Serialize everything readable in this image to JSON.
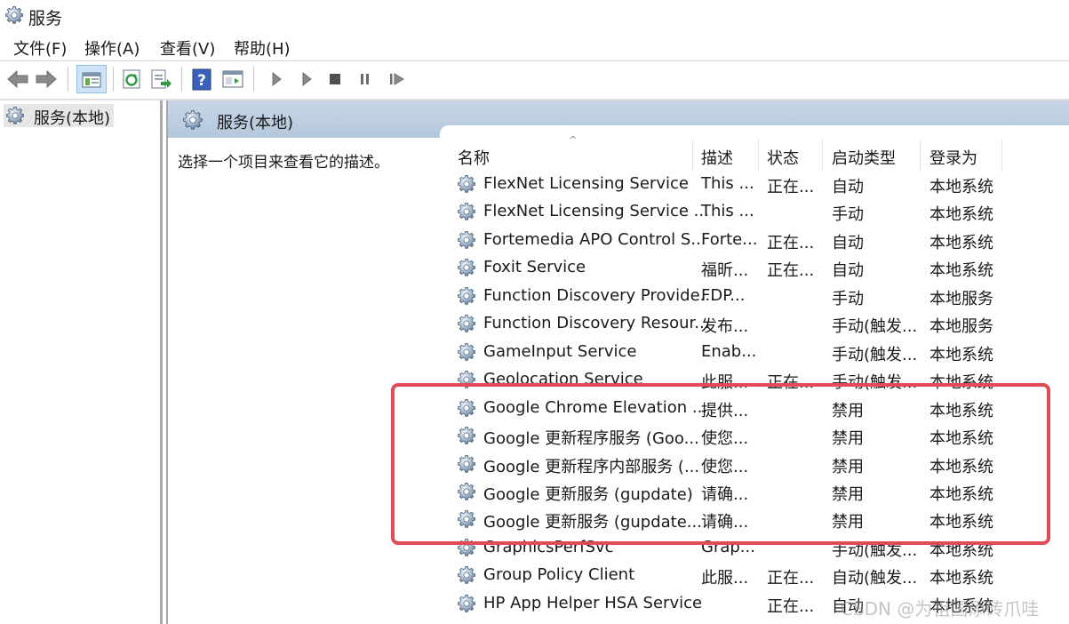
{
  "window": {
    "title": "服务",
    "icon": "services-gear-icon"
  },
  "menu": [
    "文件(F)",
    "操作(A)",
    "查看(V)",
    "帮助(H)"
  ],
  "toolbar": {
    "buttons": [
      "back-arrow-icon",
      "forward-arrow-icon",
      "show-console-tree-icon",
      "refresh-icon",
      "export-list-icon",
      "help-icon",
      "properties-icon",
      "start-service-icon",
      "start-service-alt-icon",
      "stop-service-icon",
      "pause-service-icon",
      "resume-service-icon"
    ]
  },
  "tree": {
    "selected_node": "服务(本地)"
  },
  "pane": {
    "header": "服务(本地)",
    "description_hint": "选择一个项目来查看它的描述。"
  },
  "columns": [
    "名称",
    "描述",
    "状态",
    "启动类型",
    "登录为"
  ],
  "sort_indicator": "^",
  "rows": [
    {
      "name": "FlexNet Licensing Service",
      "desc": "This ...",
      "status": "正在...",
      "startup": "自动",
      "logon": "本地系统"
    },
    {
      "name": "FlexNet Licensing Service ...",
      "desc": "This ...",
      "status": "",
      "startup": "手动",
      "logon": "本地系统"
    },
    {
      "name": "Fortemedia APO Control S...",
      "desc": "Forte...",
      "status": "正在...",
      "startup": "自动",
      "logon": "本地系统"
    },
    {
      "name": "Foxit Service",
      "desc": "福昕...",
      "status": "正在...",
      "startup": "自动",
      "logon": "本地系统"
    },
    {
      "name": "Function Discovery Provide...",
      "desc": "FDP...",
      "status": "",
      "startup": "手动",
      "logon": "本地服务"
    },
    {
      "name": "Function Discovery Resour...",
      "desc": "发布...",
      "status": "",
      "startup": "手动(触发...",
      "logon": "本地服务"
    },
    {
      "name": "GameInput Service",
      "desc": "Enab...",
      "status": "",
      "startup": "手动(触发...",
      "logon": "本地系统"
    },
    {
      "name": "Geolocation Service",
      "desc": "此服...",
      "status": "正在...",
      "startup": "手动(触发...",
      "logon": "本地系统"
    },
    {
      "name": "Google Chrome Elevation ...",
      "desc": "提供...",
      "status": "",
      "startup": "禁用",
      "logon": "本地系统"
    },
    {
      "name": "Google 更新程序服务 (Goo...",
      "desc": "使您...",
      "status": "",
      "startup": "禁用",
      "logon": "本地系统"
    },
    {
      "name": "Google 更新程序内部服务 (...",
      "desc": "使您...",
      "status": "",
      "startup": "禁用",
      "logon": "本地系统"
    },
    {
      "name": "Google 更新服务 (gupdate)",
      "desc": "请确...",
      "status": "",
      "startup": "禁用",
      "logon": "本地系统"
    },
    {
      "name": "Google 更新服务 (gupdate...",
      "desc": "请确...",
      "status": "",
      "startup": "禁用",
      "logon": "本地系统"
    },
    {
      "name": "GraphicsPerfSvc",
      "desc": "Grap...",
      "status": "",
      "startup": "手动(触发...",
      "logon": "本地系统"
    },
    {
      "name": "Group Policy Client",
      "desc": "此服...",
      "status": "正在...",
      "startup": "自动(触发...",
      "logon": "本地系统"
    },
    {
      "name": "HP App Helper HSA Service",
      "desc": "",
      "status": "正在...",
      "startup": "自动",
      "logon": "本地系统"
    }
  ],
  "annotation": {
    "highlight_color": "#e24b55"
  },
  "watermark": "CSDN @为祖国添砖爪哇"
}
